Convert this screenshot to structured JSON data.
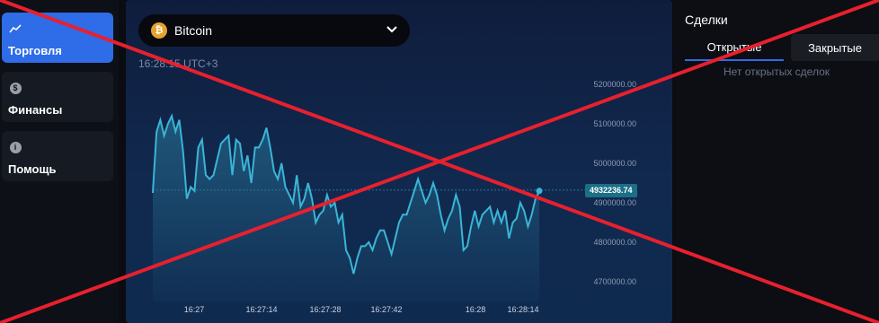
{
  "sidebar": {
    "items": [
      {
        "label": "Торговля",
        "icon": "chart-line-icon",
        "active": true
      },
      {
        "label": "Финансы",
        "icon": "dollar-icon",
        "active": false
      },
      {
        "label": "Помощь",
        "icon": "info-icon",
        "active": false
      }
    ]
  },
  "asset": {
    "name": "Bitcoin",
    "icon": "bitcoin-icon"
  },
  "time": "16:28:15 UTC+3",
  "chart_data": {
    "type": "area",
    "y_ticks": [
      "5200000.00",
      "5100000.00",
      "5000000.00",
      "4900000.00",
      "4800000.00",
      "4700000.00"
    ],
    "x_ticks": [
      "16:27",
      "16:27:14",
      "16:27:28",
      "16:27:42",
      "16:28",
      "16:28:14"
    ],
    "current_price": "4932236.74",
    "ylim": [
      4650000,
      5250000
    ],
    "values": [
      4925000,
      5080000,
      5110000,
      5070000,
      5100000,
      5120000,
      5080000,
      5110000,
      5030000,
      4910000,
      4940000,
      4930000,
      5040000,
      5060000,
      4970000,
      4960000,
      4970000,
      5010000,
      5050000,
      5060000,
      5070000,
      4970000,
      5060000,
      5050000,
      4980000,
      5020000,
      4950000,
      5040000,
      5040000,
      5060000,
      5090000,
      5040000,
      4980000,
      4960000,
      5000000,
      4940000,
      4920000,
      4900000,
      4970000,
      4890000,
      4910000,
      4950000,
      4910000,
      4850000,
      4870000,
      4880000,
      4920000,
      4890000,
      4900000,
      4850000,
      4870000,
      4780000,
      4760000,
      4720000,
      4760000,
      4790000,
      4790000,
      4800000,
      4780000,
      4810000,
      4830000,
      4830000,
      4800000,
      4770000,
      4810000,
      4850000,
      4870000,
      4870000,
      4900000,
      4930000,
      4960000,
      4930000,
      4900000,
      4920000,
      4950000,
      4920000,
      4870000,
      4830000,
      4860000,
      4880000,
      4920000,
      4890000,
      4780000,
      4790000,
      4840000,
      4880000,
      4840000,
      4870000,
      4880000,
      4890000,
      4850000,
      4880000,
      4850000,
      4880000,
      4810000,
      4850000,
      4860000,
      4900000,
      4880000,
      4840000,
      4870000,
      4910000,
      4930000
    ]
  },
  "deals": {
    "title": "Сделки",
    "tab_open": "Открытые",
    "tab_closed": "Закрытые",
    "empty": "Нет открытых сделок"
  },
  "colors": {
    "accent": "#2e6ce8",
    "line": "#3ab5d6",
    "cross": "#e8202e",
    "bitcoin": "#e8a22e"
  }
}
